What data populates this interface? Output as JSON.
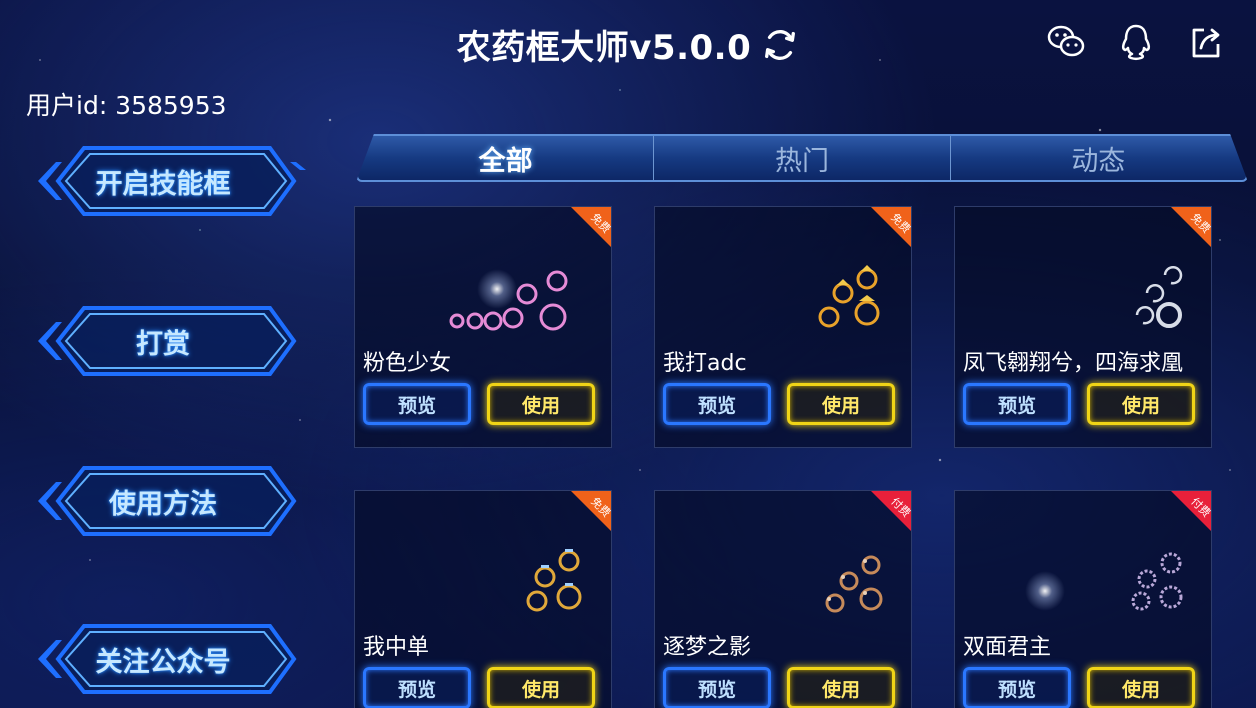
{
  "header": {
    "title": "农药框大师v5.0.0",
    "icons": [
      "refresh-icon",
      "wechat-icon",
      "qq-icon",
      "share-icon"
    ]
  },
  "user": {
    "id_text": "用户id: 3585953"
  },
  "sidebar": {
    "items": [
      {
        "label": "开启技能框"
      },
      {
        "label": "打赏"
      },
      {
        "label": "使用方法"
      },
      {
        "label": "关注公众号"
      }
    ]
  },
  "tabs": [
    {
      "label": "全部",
      "active": true
    },
    {
      "label": "热门",
      "active": false
    },
    {
      "label": "动态",
      "active": false
    }
  ],
  "cards": [
    {
      "name": "粉色少女",
      "badge": "免费",
      "badge_color": "#f0621a",
      "ring_color": "#e58bd6",
      "preview_label": "预览",
      "use_label": "使用"
    },
    {
      "name": "我打adc",
      "badge": "免费",
      "badge_color": "#f0621a",
      "ring_color": "#e8a22a",
      "preview_label": "预览",
      "use_label": "使用"
    },
    {
      "name": "凤飞翱翔兮，四海求凰",
      "badge": "免费",
      "badge_color": "#f0621a",
      "ring_color": "#d8dde8",
      "preview_label": "预览",
      "use_label": "使用"
    },
    {
      "name": "我中单",
      "badge": "免费",
      "badge_color": "#f0621a",
      "ring_color": "#e0a83a",
      "preview_label": "预览",
      "use_label": "使用"
    },
    {
      "name": "逐梦之影",
      "badge": "付费",
      "badge_color": "#e8203a",
      "ring_color": "#c68a5a",
      "preview_label": "预览",
      "use_label": "使用"
    },
    {
      "name": "双面君主",
      "badge": "付费",
      "badge_color": "#e8203a",
      "ring_color": "#b9a8d8",
      "preview_label": "预览",
      "use_label": "使用"
    }
  ]
}
